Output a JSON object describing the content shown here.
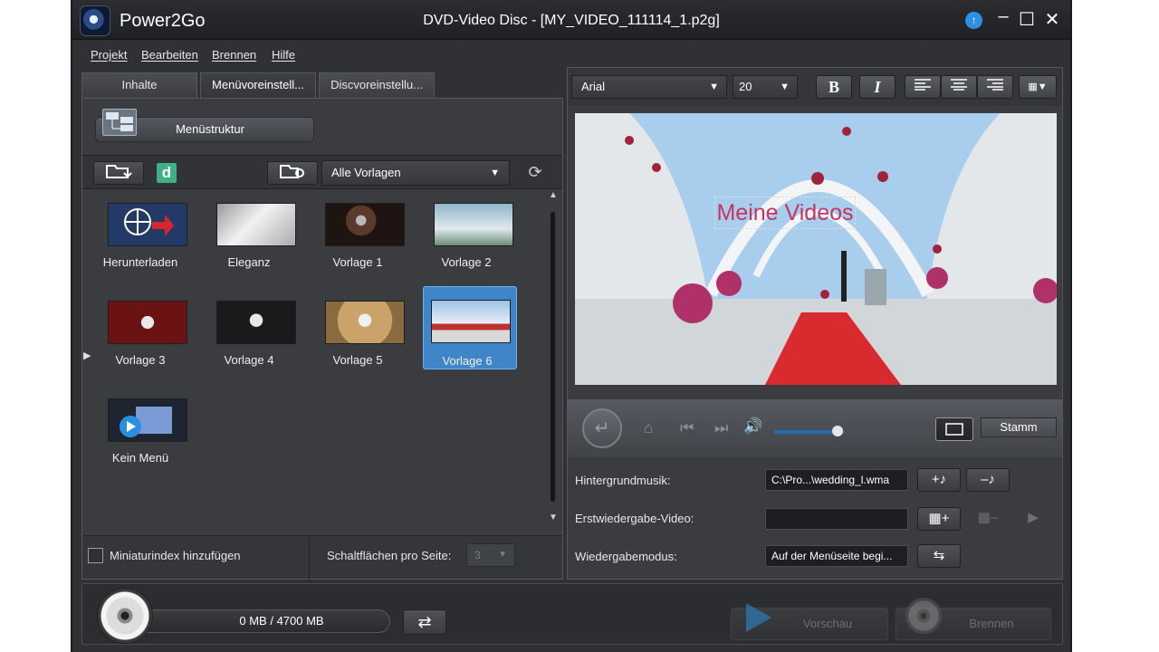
{
  "app": {
    "name": "Power2Go",
    "title": "DVD-Video Disc - [MY_VIDEO_111114_1.p2g]"
  },
  "menu": [
    "Projekt",
    "Bearbeiten",
    "Brennen",
    "Hilfe"
  ],
  "tabs": [
    {
      "label": "Inhalte",
      "active": false
    },
    {
      "label": "Menüvoreinstell...",
      "active": true
    },
    {
      "label": "Discvoreinstellu...",
      "active": false
    }
  ],
  "left": {
    "menu_structure_label": "Menüstruktur",
    "template_filter": "Alle Vorlagen",
    "templates": [
      {
        "name": "Herunterladen",
        "selected": false
      },
      {
        "name": "Eleganz",
        "selected": false
      },
      {
        "name": "Vorlage 1",
        "selected": false
      },
      {
        "name": "Vorlage 2",
        "selected": false
      },
      {
        "name": "Vorlage 3",
        "selected": false
      },
      {
        "name": "Vorlage 4",
        "selected": false
      },
      {
        "name": "Vorlage 5",
        "selected": false
      },
      {
        "name": "Vorlage 6",
        "selected": true
      },
      {
        "name": "Kein Menü",
        "selected": false
      }
    ],
    "thumb_index_label": "Miniaturindex hinzufügen",
    "buttons_per_page_label": "Schaltflächen pro Seite:",
    "buttons_per_page_value": "3"
  },
  "right": {
    "font": "Arial",
    "font_size": "20",
    "preview_text": "Meine Videos",
    "stamm_label": "Stamm",
    "volume": 0.9,
    "rows": [
      {
        "label": "Hintergrundmusik:",
        "value": "C:\\Pro...\\wedding_l.wma"
      },
      {
        "label": "Erstwiedergabe-Video:",
        "value": ""
      },
      {
        "label": "Wiedergabemodus:",
        "value": "Auf der Menüseite begi..."
      }
    ]
  },
  "bottom": {
    "capacity": "0 MB / 4700 MB",
    "preview_label": "Vorschau",
    "burn_label": "Brennen"
  },
  "icons": [
    "app-logo-icon",
    "update-icon",
    "minimize-icon",
    "maximize-icon",
    "close-icon",
    "menu-structure-icon",
    "open-folder-icon",
    "d-icon",
    "template-settings-icon",
    "refresh-icon",
    "bold-icon",
    "italic-icon",
    "align-left-icon",
    "align-center-icon",
    "align-right-icon",
    "grid-icon",
    "return-icon",
    "home-icon",
    "prev-icon",
    "next-icon",
    "volume-icon",
    "aspect-icon",
    "add-music-icon",
    "remove-music-icon",
    "add-video-icon",
    "remove-video-icon",
    "play-icon",
    "playback-mode-icon",
    "disc-icon",
    "swap-icon",
    "preview-play-icon",
    "burn-disc-icon"
  ],
  "colors": {
    "accent": "#3f86c8",
    "background": "#2f3135"
  }
}
